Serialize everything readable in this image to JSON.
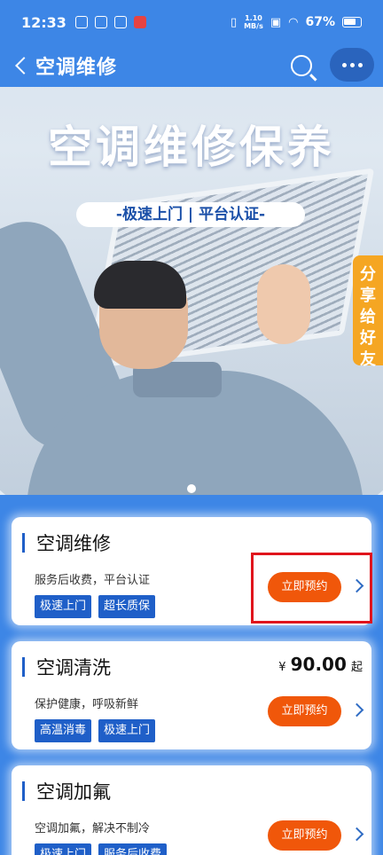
{
  "status_bar": {
    "time": "12:33",
    "net_speed_top": "1.10",
    "net_speed_bottom": "MB/s",
    "battery": "67%"
  },
  "nav": {
    "title": "空调维修"
  },
  "banner": {
    "title": "空调维修保养",
    "tagline": "-极速上门 | 平台认证-",
    "share_label": "分享给好友"
  },
  "services": [
    {
      "title": "空调维修",
      "desc": "服务后收费，平台认证",
      "tags": [
        "极速上门",
        "超长质保"
      ],
      "button": "立即预约"
    },
    {
      "title": "空调清洗",
      "desc": "保护健康，呼吸新鲜",
      "tags": [
        "高温消毒",
        "极速上门"
      ],
      "price_symbol": "¥",
      "price": "90.00",
      "price_suffix": "起",
      "button": "立即预约"
    },
    {
      "title": "空调加氟",
      "desc": "空调加氟，解决不制冷",
      "tags": [
        "极速上门",
        "服务后收费"
      ],
      "button": "立即预约"
    }
  ],
  "colors": {
    "background": "#3d86e6",
    "primary": "#1f5fc8",
    "cta": "#f0570a",
    "share": "#f5a623",
    "highlight": "#e0141c"
  }
}
